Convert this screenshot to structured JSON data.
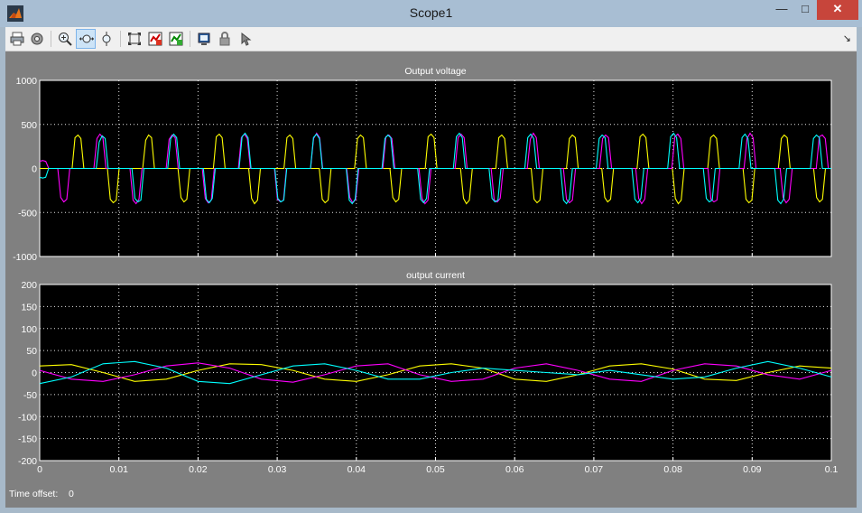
{
  "window": {
    "title": "Scope1",
    "minimize": "—",
    "maximize": "□",
    "close": "✕"
  },
  "toolbar": {
    "icons": [
      "print-icon",
      "parameters-icon",
      "zoom-icon",
      "zoom-x-icon",
      "zoom-y-icon",
      "autoscale-icon",
      "save-axes-icon",
      "restore-axes-icon",
      "floating-scope-icon",
      "lock-icon",
      "signal-selector-icon"
    ],
    "active": "zoom-x-icon",
    "dock": "↘"
  },
  "time_offset": {
    "label": "Time offset:",
    "value": "0"
  },
  "colors": {
    "yellow": "#ffff00",
    "magenta": "#ff00ff",
    "cyan": "#00ffff",
    "background": "#000000",
    "frame": "#808080"
  },
  "chart_data": [
    {
      "type": "line",
      "title": "Output voltage",
      "xlim": [
        0,
        0.1
      ],
      "ylim": [
        -1000,
        1000
      ],
      "x_ticks": [
        "0",
        "0.01",
        "0.02",
        "0.03",
        "0.04",
        "0.05",
        "0.06",
        "0.07",
        "0.08",
        "0.09",
        "0.1"
      ],
      "y_ticks": [
        "1000",
        "500",
        "0",
        "-500",
        "-1000"
      ],
      "grid": true,
      "sample_dt": 0.0004,
      "series": [
        {
          "color": "#ffff00",
          "amplitude": 400,
          "phase_deg": 0,
          "values": [
            0,
            0,
            0,
            0,
            0,
            0,
            0,
            0,
            0,
            0,
            0,
            0,
            350,
            380,
            340,
            0,
            0,
            0,
            0,
            0,
            0,
            0,
            0,
            0,
            -350,
            -390,
            -360,
            0,
            0,
            0,
            0,
            0,
            0,
            0,
            0,
            0,
            320,
            380,
            350,
            0,
            0,
            0,
            0,
            0,
            0,
            0,
            0,
            0,
            -330,
            -380,
            -350,
            0,
            0,
            0,
            0,
            0,
            0,
            0,
            0,
            0,
            360,
            390,
            350,
            0,
            0,
            0,
            0,
            0,
            0,
            0,
            0,
            0,
            -340,
            -400,
            -360,
            0,
            0,
            0,
            0,
            0,
            0,
            0,
            0,
            0,
            350,
            380,
            340,
            0,
            0,
            0,
            0,
            0,
            0,
            0,
            0,
            0,
            -350,
            -390,
            -360,
            0,
            0,
            0,
            0,
            0,
            0,
            0,
            0,
            0,
            340,
            380,
            350,
            0,
            0,
            0,
            0,
            0,
            0,
            0,
            0,
            0,
            -330,
            -380,
            -350,
            0,
            0,
            0,
            0,
            0,
            0,
            0,
            0,
            0,
            360,
            390,
            350,
            0,
            0,
            0,
            0,
            0,
            0,
            0,
            0,
            0,
            -340,
            -400,
            -360,
            0,
            0,
            0,
            0,
            0,
            0,
            0,
            0,
            0,
            350,
            380,
            340,
            0,
            0,
            0,
            0,
            0,
            0,
            0,
            0,
            0,
            -350,
            -390,
            -360,
            0,
            0,
            0,
            0,
            0,
            0,
            0,
            0,
            0,
            340,
            380,
            350,
            0,
            0,
            0,
            0,
            0,
            0,
            0,
            0,
            0,
            -330,
            -380,
            -350,
            0,
            0,
            0,
            0,
            0,
            0,
            0,
            0,
            0,
            360,
            390,
            350,
            0,
            0,
            0,
            0,
            0,
            0,
            0,
            0,
            0,
            -340,
            -400,
            -360,
            0,
            0,
            0,
            0,
            0,
            0,
            0,
            0,
            0,
            350,
            380,
            340,
            0,
            0,
            0,
            0,
            0,
            0,
            0,
            0,
            0,
            -350,
            -390,
            -360,
            0,
            0,
            0,
            0,
            0,
            0,
            0,
            0,
            0,
            340,
            380,
            350,
            0,
            0,
            0,
            0,
            0,
            0,
            0,
            0,
            0,
            -330,
            -380,
            -350,
            0,
            0,
            0
          ]
        },
        {
          "color": "#ff00ff",
          "amplitude": 400,
          "phase_deg": 120,
          "values": [
            80,
            90,
            80,
            0,
            0,
            0,
            0,
            -330,
            -380,
            -350,
            0,
            0,
            0,
            0,
            0,
            0,
            0,
            0,
            0,
            340,
            390,
            350,
            0,
            0,
            0,
            0,
            0,
            0,
            0,
            0,
            0,
            -360,
            -400,
            -350,
            0,
            0,
            0,
            0,
            0,
            0,
            0,
            0,
            0,
            330,
            380,
            350,
            0,
            0,
            0,
            0,
            0,
            0,
            0,
            0,
            0,
            -340,
            -390,
            -360,
            0,
            0,
            0,
            0,
            0,
            0,
            0,
            0,
            0,
            350,
            390,
            340,
            0,
            0,
            0,
            0,
            0,
            0,
            0,
            0,
            0,
            -350,
            -380,
            -360,
            0,
            0,
            0,
            0,
            0,
            0,
            0,
            0,
            0,
            340,
            400,
            350,
            0,
            0,
            0,
            0,
            0,
            0,
            0,
            0,
            0,
            -330,
            -390,
            -350,
            0,
            0,
            0,
            0,
            0,
            0,
            0,
            0,
            0,
            360,
            380,
            340,
            0,
            0,
            0,
            0,
            0,
            0,
            0,
            0,
            0,
            -340,
            -400,
            -360,
            0,
            0,
            0,
            0,
            0,
            0,
            0,
            0,
            0,
            350,
            390,
            350,
            0,
            0,
            0,
            0,
            0,
            0,
            0,
            0,
            0,
            -360,
            -380,
            -340,
            0,
            0,
            0,
            0,
            0,
            0,
            0,
            0,
            0,
            330,
            400,
            350,
            0,
            0,
            0,
            0,
            0,
            0,
            0,
            0,
            0,
            -350,
            -390,
            -360,
            0,
            0,
            0,
            0,
            0,
            0,
            0,
            0,
            0,
            340,
            380,
            350,
            0,
            0,
            0,
            0,
            0,
            0,
            0,
            0,
            0,
            -340,
            -400,
            -350,
            0,
            0,
            0,
            0,
            0,
            0,
            0,
            0,
            0,
            360,
            390,
            340,
            0,
            0,
            0,
            0,
            0,
            0,
            0,
            0,
            0,
            -350,
            -380,
            -360,
            0,
            0,
            0,
            0,
            0,
            0,
            0,
            0,
            0,
            340,
            400,
            350,
            0,
            0,
            0,
            0,
            0,
            0,
            0,
            0,
            0,
            -330,
            -390,
            -350,
            0,
            0,
            0,
            0,
            0,
            0,
            0,
            0,
            0,
            360,
            380,
            340,
            0,
            0
          ]
        },
        {
          "color": "#00ffff",
          "amplitude": 400,
          "phase_deg": 240,
          "values": [
            -100,
            -110,
            -100,
            0,
            0,
            0,
            0,
            0,
            0,
            0,
            0,
            0,
            0,
            0,
            0,
            0,
            0,
            0,
            0,
            0,
            300,
            370,
            340,
            0,
            0,
            0,
            0,
            0,
            0,
            0,
            0,
            0,
            -340,
            -380,
            -360,
            0,
            0,
            0,
            0,
            0,
            0,
            0,
            0,
            0,
            340,
            390,
            350,
            0,
            0,
            0,
            0,
            0,
            0,
            0,
            0,
            0,
            -350,
            -390,
            -340,
            0,
            0,
            0,
            0,
            0,
            0,
            0,
            0,
            0,
            360,
            400,
            350,
            0,
            0,
            0,
            0,
            0,
            0,
            0,
            0,
            0,
            -340,
            -380,
            -360,
            0,
            0,
            0,
            0,
            0,
            0,
            0,
            0,
            0,
            350,
            390,
            340,
            0,
            0,
            0,
            0,
            0,
            0,
            0,
            0,
            0,
            -360,
            -400,
            -350,
            0,
            0,
            0,
            0,
            0,
            0,
            0,
            0,
            0,
            340,
            380,
            350,
            0,
            0,
            0,
            0,
            0,
            0,
            0,
            0,
            0,
            -350,
            -390,
            -340,
            0,
            0,
            0,
            0,
            0,
            0,
            0,
            0,
            0,
            360,
            400,
            350,
            0,
            0,
            0,
            0,
            0,
            0,
            0,
            0,
            0,
            -340,
            -380,
            -360,
            0,
            0,
            0,
            0,
            0,
            0,
            0,
            0,
            0,
            350,
            390,
            340,
            0,
            0,
            0,
            0,
            0,
            0,
            0,
            0,
            0,
            -360,
            -400,
            -350,
            0,
            0,
            0,
            0,
            0,
            0,
            0,
            0,
            0,
            340,
            380,
            350,
            0,
            0,
            0,
            0,
            0,
            0,
            0,
            0,
            0,
            -350,
            -390,
            -340,
            0,
            0,
            0,
            0,
            0,
            0,
            0,
            0,
            0,
            360,
            400,
            350,
            0,
            0,
            0,
            0,
            0,
            0,
            0,
            0,
            0,
            -340,
            -380,
            -360,
            0,
            0,
            0,
            0,
            0,
            0,
            0,
            0,
            0,
            350,
            390,
            340,
            0,
            0,
            0,
            0,
            0,
            0,
            0,
            0,
            0,
            -360,
            -400,
            -350,
            0,
            0,
            0,
            0,
            0,
            0,
            0,
            0,
            0,
            340,
            380,
            350,
            0,
            0,
            0,
            0
          ]
        }
      ]
    },
    {
      "type": "line",
      "title": "output current",
      "xlim": [
        0,
        0.1
      ],
      "ylim": [
        -200,
        200
      ],
      "x_ticks": [
        "0",
        "0.01",
        "0.02",
        "0.03",
        "0.04",
        "0.05",
        "0.06",
        "0.07",
        "0.08",
        "0.09",
        "0.1"
      ],
      "y_ticks": [
        "200",
        "150",
        "100",
        "50",
        "0",
        "-50",
        "-100",
        "-150",
        "-200"
      ],
      "grid": true,
      "series": [
        {
          "color": "#ffff00",
          "x": [
            0,
            0.004,
            0.008,
            0.012,
            0.016,
            0.02,
            0.024,
            0.028,
            0.032,
            0.036,
            0.04,
            0.044,
            0.048,
            0.052,
            0.056,
            0.06,
            0.064,
            0.068,
            0.072,
            0.076,
            0.08,
            0.084,
            0.088,
            0.092,
            0.096,
            0.1
          ],
          "values": [
            15,
            18,
            0,
            -20,
            -15,
            5,
            20,
            18,
            5,
            -15,
            -20,
            -5,
            15,
            20,
            10,
            -15,
            -20,
            -5,
            15,
            20,
            8,
            -15,
            -18,
            0,
            15,
            10
          ]
        },
        {
          "color": "#ff00ff",
          "x": [
            0,
            0.004,
            0.008,
            0.012,
            0.016,
            0.02,
            0.024,
            0.028,
            0.032,
            0.036,
            0.04,
            0.044,
            0.048,
            0.052,
            0.056,
            0.06,
            0.064,
            0.068,
            0.072,
            0.076,
            0.08,
            0.084,
            0.088,
            0.092,
            0.096,
            0.1
          ],
          "values": [
            5,
            -15,
            -20,
            -5,
            15,
            22,
            10,
            -15,
            -22,
            -5,
            15,
            20,
            -5,
            -20,
            -15,
            10,
            20,
            5,
            -15,
            -20,
            5,
            20,
            15,
            -5,
            -15,
            5
          ]
        },
        {
          "color": "#00ffff",
          "x": [
            0,
            0.004,
            0.008,
            0.012,
            0.016,
            0.02,
            0.024,
            0.028,
            0.032,
            0.036,
            0.04,
            0.044,
            0.048,
            0.052,
            0.056,
            0.06,
            0.064,
            0.068,
            0.072,
            0.076,
            0.08,
            0.084,
            0.088,
            0.092,
            0.096,
            0.1
          ],
          "values": [
            -25,
            -10,
            20,
            25,
            10,
            -20,
            -25,
            -5,
            15,
            20,
            5,
            -15,
            -15,
            0,
            10,
            5,
            0,
            -5,
            5,
            -5,
            -15,
            -10,
            10,
            25,
            10,
            -10
          ]
        }
      ]
    }
  ]
}
